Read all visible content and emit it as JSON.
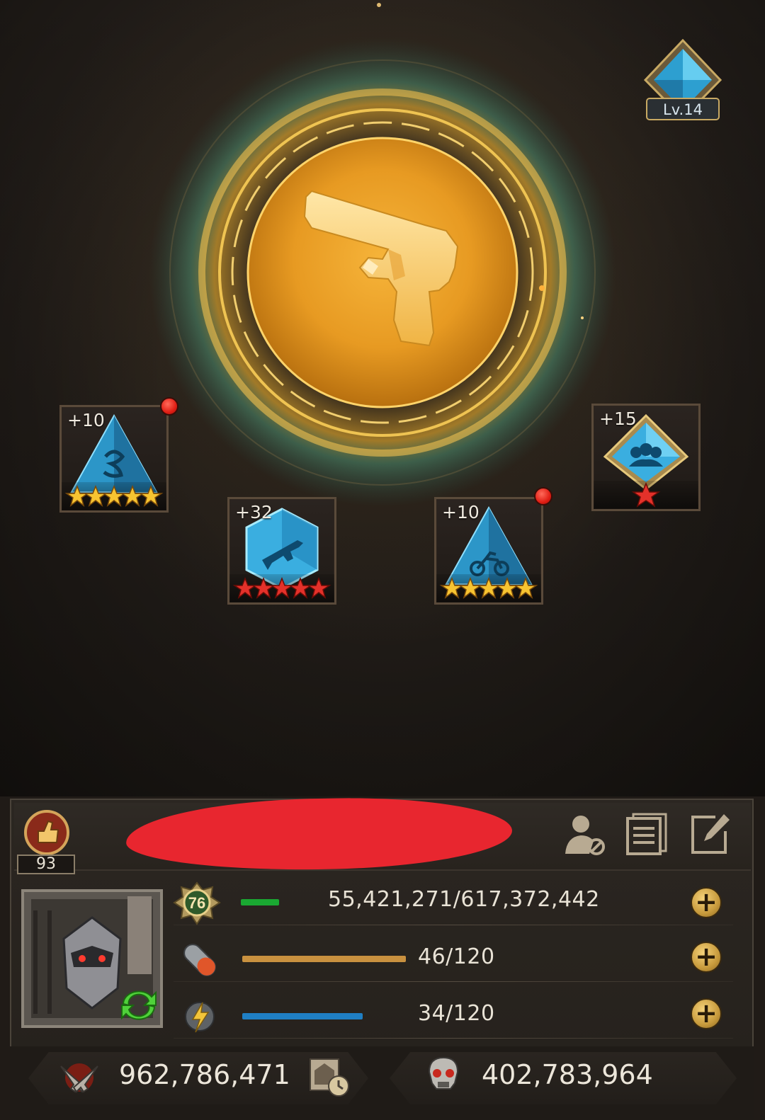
{
  "equipment": {
    "main_icon": "pistol-icon",
    "level_badge": {
      "label": "Lv.14",
      "icon": "blue-diamond-icon"
    },
    "slots": [
      {
        "plus": "+10",
        "icon": "tactics-triangle-icon",
        "stars": 5,
        "star_color": "gold",
        "notification": true
      },
      {
        "plus": "+32",
        "icon": "rifle-hexagon-icon",
        "stars": 5,
        "star_color": "red",
        "notification": false
      },
      {
        "plus": "+10",
        "icon": "motorcycle-triangle-icon",
        "stars": 5,
        "star_color": "gold",
        "notification": true
      },
      {
        "plus": "+15",
        "icon": "squad-diamond-icon",
        "stars": 1,
        "star_color": "red",
        "notification": false
      }
    ]
  },
  "profile": {
    "likes": "93",
    "level": "76",
    "icons": [
      "thumbs-up-medal-icon",
      "block-user-icon",
      "list-icon",
      "edit-icon"
    ]
  },
  "stats": [
    {
      "icon": "level-badge-icon",
      "value": "55,421,271/617,372,442",
      "fill": 0.09,
      "color": "#1aa832"
    },
    {
      "icon": "stamina-capsule-icon",
      "value": "46/120",
      "fill": 1.0,
      "color": "#c9913f"
    },
    {
      "icon": "energy-bolt-icon",
      "value": "34/120",
      "fill": 0.7,
      "color": "#1f7fc4"
    }
  ],
  "resources": [
    {
      "icon": "crossed-pistols-icon",
      "value": "962,786,471"
    },
    {
      "icon": "skull-mask-icon",
      "value": "402,783,964"
    }
  ],
  "colors": {
    "accent_gold": "#f3b52c",
    "gem_blue": "#3fb7e6",
    "panel": "#2b2621"
  }
}
